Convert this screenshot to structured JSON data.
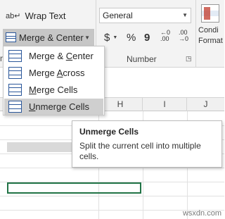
{
  "ribbon": {
    "wrap_text_label": "Wrap Text",
    "merge_center_label": "Merge & Center",
    "number_format_value": "General",
    "number_group_label": "Number",
    "currency_symbol": "$",
    "percent_symbol": "%",
    "comma_symbol": "9",
    "increase_decimal": "←0 .00",
    "decrease_decimal": ".00 →0",
    "conditional_label_1": "Condi",
    "conditional_label_2": "Format",
    "left_group_letter": "m"
  },
  "merge_menu": {
    "items": [
      {
        "label": "Merge & Center",
        "underline": "C",
        "icon": "merge-center-icon"
      },
      {
        "label": "Merge Across",
        "underline": "A",
        "icon": "merge-across-icon"
      },
      {
        "label": "Merge Cells",
        "underline": "M",
        "icon": "merge-cells-icon"
      },
      {
        "label": "Unmerge Cells",
        "underline": "U",
        "icon": "unmerge-cells-icon",
        "hovered": true
      }
    ]
  },
  "columns": [
    "H",
    "I",
    "J"
  ],
  "tooltip": {
    "title": "Unmerge Cells",
    "body": "Split the current cell into multiple cells."
  },
  "watermark": "wsxdn.com",
  "colors": {
    "accent_green": "#217346",
    "menu_hover": "#cfcfcf",
    "icon_blue": "#2b579a"
  }
}
